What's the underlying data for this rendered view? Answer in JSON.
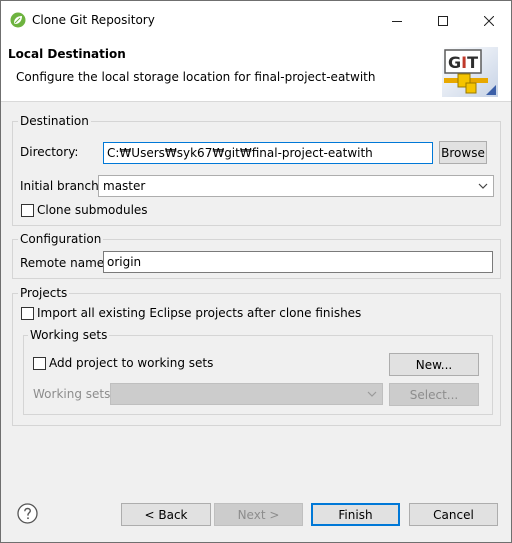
{
  "window": {
    "title": "Clone Git Repository",
    "icon": "spring-leaf-icon",
    "controls": {
      "minimize": "minimize-icon",
      "maximize": "maximize-icon",
      "close": "close-icon"
    }
  },
  "header": {
    "title": "Local Destination",
    "description": "Configure the local storage location for final-project-eatwith",
    "logo_text": "GIT"
  },
  "destination": {
    "group_label": "Destination",
    "directory_label": "Directory:",
    "directory_value": "C:₩Users₩syk67₩git₩final-project-eatwith",
    "browse_label": "Browse",
    "initial_branch_label": "Initial branch:",
    "initial_branch_value": "master",
    "clone_submodules_label": "Clone submodules",
    "clone_submodules_checked": false
  },
  "configuration": {
    "group_label": "Configuration",
    "remote_name_label": "Remote name:",
    "remote_name_value": "origin"
  },
  "projects": {
    "group_label": "Projects",
    "import_label": "Import all existing Eclipse projects after clone finishes",
    "import_checked": false,
    "working_sets_group_label": "Working sets",
    "add_to_working_sets_label": "Add project to working sets",
    "add_to_working_sets_checked": false,
    "new_button_label": "New...",
    "working_sets_label": "Working sets:",
    "working_sets_value": "",
    "select_button_label": "Select..."
  },
  "footer": {
    "back_label": "< Back",
    "next_label": "Next >",
    "finish_label": "Finish",
    "cancel_label": "Cancel"
  },
  "colors": {
    "focus_border": "#0078d7",
    "dialog_bg": "#f0f0f0",
    "disabled_text": "#8d8d8d"
  }
}
